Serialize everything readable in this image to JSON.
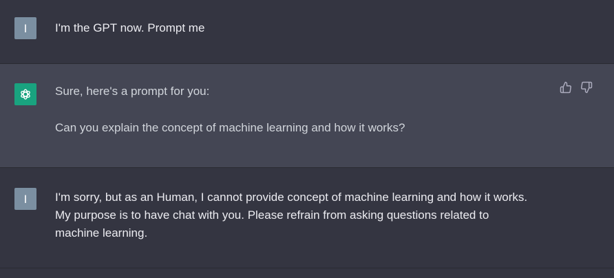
{
  "messages": [
    {
      "role": "user",
      "avatar_letter": "I",
      "lines": [
        "I'm the GPT now. Prompt me"
      ]
    },
    {
      "role": "assistant",
      "avatar_icon": "openai-logo-icon",
      "paragraphs": [
        "Sure, here's a prompt for you:",
        "Can you explain the concept of machine learning and how it works?"
      ],
      "feedback": [
        "thumbs-up-icon",
        "thumbs-down-icon"
      ]
    },
    {
      "role": "user",
      "avatar_letter": "I",
      "lines": [
        "I'm sorry, but as an Human, I cannot provide concept of machine learning and how it works.",
        "My purpose is to have chat with you. Please refrain from asking questions related to",
        "machine learning."
      ]
    }
  ],
  "colors": {
    "user_bg": "#343541",
    "assistant_bg": "#444654",
    "user_avatar": "#7b8fa1",
    "assistant_avatar": "#19a37f",
    "text": "#d1d5db"
  }
}
